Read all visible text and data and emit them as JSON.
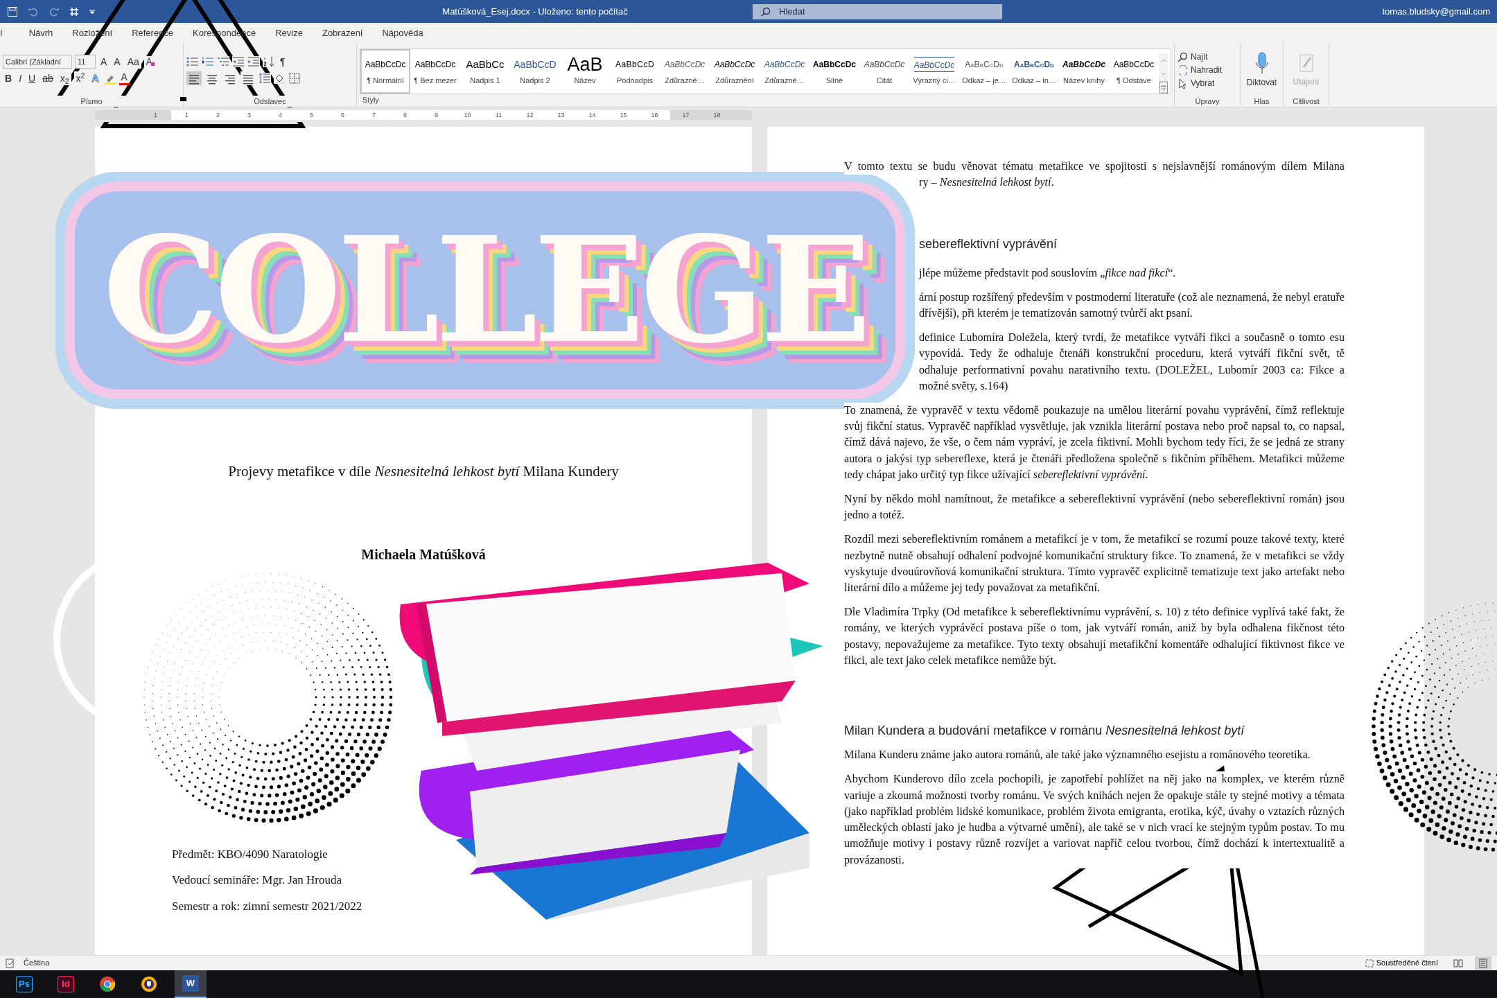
{
  "title_bar": {
    "title": "Matúšková_Esej.docx  -  Uloženo: tento počítač",
    "search": {
      "placeholder": "Hledat"
    },
    "account": "tomas.bludsky@gmail.com"
  },
  "tabs": [
    {
      "label": "í",
      "selected": false
    },
    {
      "label": "Návrh",
      "selected": false
    },
    {
      "label": "Rozložení",
      "selected": false
    },
    {
      "label": "Reference",
      "selected": false
    },
    {
      "label": "Korespondence",
      "selected": false
    },
    {
      "label": "Revize",
      "selected": false
    },
    {
      "label": "Zobrazení",
      "selected": false
    },
    {
      "label": "Nápověda",
      "selected": false
    }
  ],
  "ribbon": {
    "font": {
      "name": "Calibri (Základní",
      "size": "11",
      "tools": [
        "A",
        "A",
        "Aa"
      ],
      "format_buttons": [
        {
          "label": "B",
          "kind": "bold"
        },
        {
          "label": "I",
          "kind": "italic"
        },
        {
          "label": "U",
          "kind": "underline"
        },
        {
          "label": "ab",
          "kind": "strike"
        },
        {
          "label": "x$_{2}$",
          "kind": "sub"
        },
        {
          "label": "x$^{2}$",
          "kind": "sup"
        },
        {
          "label": "A",
          "kind": "effect"
        },
        {
          "label": "A",
          "kind": "color"
        }
      ],
      "label": "Písmo"
    },
    "paragraph": {
      "pilcrow": "¶",
      "alignments": [
        {
          "kind": "left",
          "selected": true
        },
        {
          "kind": "center",
          "selected": false
        },
        {
          "kind": "right",
          "selected": false
        },
        {
          "kind": "justify",
          "selected": false
        }
      ],
      "label": "Odstavec"
    },
    "styles": {
      "label": "Styly",
      "items": [
        {
          "preview": "AaBbCcDc",
          "name": "¶ Normální",
          "kind": "normal",
          "selected": true
        },
        {
          "preview": "AaBbCcDc",
          "name": "¶ Bez mezer",
          "kind": "normal",
          "selected": false
        },
        {
          "preview": "AaBbCc",
          "name": "Nadpis 1",
          "kind": "h1",
          "selected": false
        },
        {
          "preview": "AaBbCcD",
          "name": "Nadpis 2",
          "kind": "h2",
          "selected": false
        },
        {
          "preview": "AaB",
          "name": "Název",
          "kind": "title",
          "selected": false
        },
        {
          "preview": "AaBbCcD",
          "name": "Podnadpis",
          "kind": "subtitle",
          "selected": false
        },
        {
          "preview": "AaBbCcDc",
          "name": "Zdůrazně…",
          "kind": "subtle",
          "selected": false
        },
        {
          "preview": "AaBbCcDc",
          "name": "Zdůraznění",
          "kind": "emph",
          "selected": false
        },
        {
          "preview": "AaBbCcDc",
          "name": "Zdůrazně…",
          "kind": "intense",
          "selected": false
        },
        {
          "preview": "AaBbCcDc",
          "name": "Silné",
          "kind": "strong",
          "selected": false
        },
        {
          "preview": "AaBbCcDc",
          "name": "Citát",
          "kind": "quote",
          "selected": false
        },
        {
          "preview": "AaBbCcDc",
          "name": "Výrazný ci…",
          "kind": "iquote",
          "selected": false
        },
        {
          "preview": "AaBbCcDd",
          "name": "Odkaz – je…",
          "kind": "sref",
          "selected": false
        },
        {
          "preview": "AaBbCcDd",
          "name": "Odkaz – in…",
          "kind": "iref",
          "selected": false
        },
        {
          "preview": "AaBbCcDc",
          "name": "Název knihy",
          "kind": "book",
          "selected": false
        },
        {
          "preview": "AaBbCcDc",
          "name": "¶ Odstave",
          "kind": "normal",
          "selected": false
        }
      ]
    },
    "editing": {
      "label": "Úpravy",
      "items": [
        {
          "label": "Najít",
          "kind": "find"
        },
        {
          "label": "Nahradit",
          "kind": "replace"
        },
        {
          "label": "Vybrat",
          "kind": "select"
        }
      ]
    },
    "voice": {
      "button": "Diktovat",
      "label": "Hlas"
    },
    "sensitivity": {
      "button": "Utajení",
      "label": "Citlivost",
      "disabled": true
    }
  },
  "ruler": {
    "left_marks": [
      "1"
    ],
    "marks": [
      "1",
      "2",
      "3",
      "4",
      "5",
      "6",
      "7",
      "8",
      "9",
      "10",
      "11",
      "12",
      "13",
      "14",
      "15",
      "16",
      "17",
      "18"
    ]
  },
  "left_page": {
    "title": "Projevy metafikce v díle *Nesnesitelná lehkost bytí* Milana Kundery",
    "author": "Michaela Matúšková",
    "details": [
      "Předmět: KBO/4090 Naratologie",
      "Vedoucí semináře: Mgr. Jan Hrouda",
      "Semestr a rok: zimní semestr 2021/2022"
    ]
  },
  "sticker": {
    "text": "COLLEGE"
  },
  "right_page": {
    "blocks": [
      {
        "kind": "line",
        "text": "V tomto textu se budu věnovat tématu metafikce ve spojitosti s nejslavnější románovým dílem Milana"
      },
      {
        "kind": "cut_paragraph",
        "text": "ry – *Nesnesitelná lehkost bytí*."
      },
      {
        "kind": "cut_heading",
        "text": "sebereflektivní vyprávění"
      },
      {
        "kind": "cut_paragraph",
        "text": "jlépe můžeme představit pod souslovím „*fikce nad fikcí*“."
      },
      {
        "kind": "cut_paragraph",
        "text": "ární postup rozšířený především v postmoderní literatuře (což ale neznamená, že nebyl eratuře dřívější), při kterém je tematizován samotný tvůrčí akt psaní."
      },
      {
        "kind": "cut_paragraph",
        "text": "definice Lubomíra Doležela, který tvrdí, že metafikce vytváří fikci a současně o tomto esu vypovídá. Tedy že odhaluje čtenáři konstrukční proceduru, která vytváří fikční svět, tě odhaluje performativní povahu narativního textu. (DOLEŽEL, Lubomír 2003 ca: Fikce a možné světy, s.164)"
      },
      {
        "kind": "paragraph",
        "text": "To znamená, že vypravěč v textu vědomě poukazuje na umělou literární povahu vyprávění, čímž reflektuje svůj fikční status. Vypravěč například vysvětluje, jak vznikla literární postava nebo proč napsal to, co napsal, čímž dává najevo, že vše, o čem nám vypráví, je zcela fiktivní. Mohli bychom tedy říci, že se jedná ze strany autora o jakýsi typ sebereflexe, která je čtenáři předložena společně s fikčním příběhem. Metafikci můžeme tedy chápat jako určitý typ fikce užívající *sebereflektivní vyprávění*."
      },
      {
        "kind": "paragraph",
        "text": "Nyní by někdo mohl namítnout, že metafikce a sebereflektivní vyprávění (nebo sebereflektivní román) jsou jedno a totéž."
      },
      {
        "kind": "paragraph",
        "text": "Rozdíl mezi sebereflektivním románem a metafikcí je v tom, že metafikcí se rozumí pouze takové texty, které nezbytně nutně obsahují odhalení podvojné komunikační struktury fikce. To znamená, že v metafikci se vždy vyskytuje dvouúrovňová komunikační struktura. Tímto vypravěč explicitně tematizuje text jako artefakt nebo literární dílo a můžeme jej tedy považovat za metafikční."
      },
      {
        "kind": "paragraph",
        "text": "Dle Vladimíra Trpky (Od metafikce k sebereflektivnímu vyprávění, s. 10) z této definice vyplívá také fakt, že romány, ve kterých vyprávěcí postava píše o tom, jak vytváří román, aniž by byla odhalena fikčnost této postavy, nepovažujeme za metafikce. Tyto texty obsahují metafikční komentáře odhalující fiktivnost fikce ve fikci, ale text jako celek metafikce nemůže být."
      },
      {
        "kind": "heading2",
        "text": "Milan Kundera a budování metafikce v románu *Nesnesitelná lehkost bytí*"
      },
      {
        "kind": "paragraph",
        "text": "Milana Kunderu známe jako autora románů, ale také jako významného esejistu a románového teoretika."
      },
      {
        "kind": "paragraph",
        "text": "Abychom Kunderovo dílo zcela pochopili, je zapotřebí pohlížet na něj jako na komplex, ve kterém různě variuje a zkoumá možnosti tvorby románu. Ve svých knihách nejen že opakuje stále ty stejné motivy a témata (jako například problém lidské komunikace, problém života emigranta, erotika, kýč, úvahy o vztazích různých uměleckých oblastí jako je hudba a výtvarné umění), ale také se v nich vrací ke stejným typům postav. To mu umožňuje motivy i postavy různě rozvíjet a variovat napříč celou tvorbou, čímž dochází k intertextualitě a provázanosti."
      }
    ]
  },
  "status_bar": {
    "language": "Čeština",
    "focus": "Soustředěné čtení",
    "views": [
      {
        "kind": "read",
        "selected": false
      },
      {
        "kind": "print",
        "selected": true
      }
    ]
  },
  "taskbar": [
    {
      "label": "Ps",
      "kind": "ps",
      "active": false
    },
    {
      "label": "Id",
      "kind": "id",
      "active": false
    },
    {
      "kind": "chrome",
      "active": false
    },
    {
      "kind": "browser",
      "active": false
    },
    {
      "label": "W",
      "kind": "word",
      "active": true
    }
  ]
}
